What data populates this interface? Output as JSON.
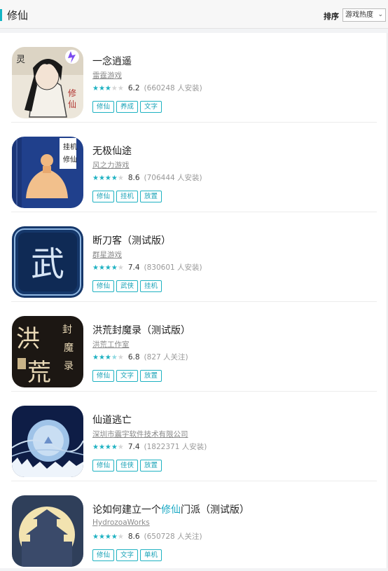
{
  "header": {
    "title": "修仙",
    "sort_label": "排序",
    "sort_value": "游戏热度",
    "accent": "#14b5c5"
  },
  "games": [
    {
      "name": "一念逍遥",
      "name_suffix": "",
      "name_highlight": "",
      "developer": "雷霆游戏",
      "stars": 3,
      "score": "6.2",
      "count": "(660248 人安装)",
      "tags": [
        "修仙",
        "养成",
        "文字"
      ],
      "icon": "yinian-xiaoyao-icon"
    },
    {
      "name": "无极仙途",
      "name_suffix": "",
      "name_highlight": "",
      "developer": "风之力游戏",
      "stars": 4,
      "score": "8.6",
      "count": "(706444 人安装)",
      "tags": [
        "修仙",
        "挂机",
        "放置"
      ],
      "icon": "wuji-xiantu-icon"
    },
    {
      "name": "断刀客（测试版）",
      "name_suffix": "",
      "name_highlight": "",
      "developer": "群星游戏",
      "stars": 4,
      "score": "7.4",
      "count": "(830601 人安装)",
      "tags": [
        "修仙",
        "武侠",
        "挂机"
      ],
      "icon": "duandaoke-icon"
    },
    {
      "name": "洪荒封魔录（测试版）",
      "name_suffix": "",
      "name_highlight": "",
      "developer": "洪荒工作室",
      "stars": 3.5,
      "score": "6.8",
      "count": "(827 人关注)",
      "tags": [
        "修仙",
        "文字",
        "放置"
      ],
      "icon": "honghuang-icon"
    },
    {
      "name": "仙道逃亡",
      "name_suffix": "",
      "name_highlight": "",
      "developer": "深圳市震宇软件技术有限公司",
      "stars": 4,
      "score": "7.4",
      "count": "(1822371 人安装)",
      "tags": [
        "修仙",
        "佳侠",
        "放置"
      ],
      "icon": "xiandao-taowang-icon"
    },
    {
      "name": "论如何建立一个",
      "name_highlight": "修仙",
      "name_suffix": "门派（测试版）",
      "developer": "HydrozoaWorks",
      "stars": 4,
      "score": "8.6",
      "count": "(650728 人关注)",
      "tags": [
        "修仙",
        "文字",
        "单机"
      ],
      "icon": "xiupai-icon"
    }
  ]
}
